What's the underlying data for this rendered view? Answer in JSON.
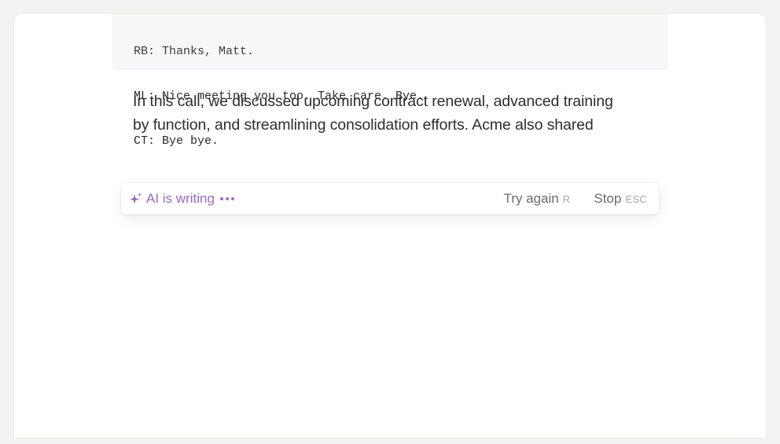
{
  "transcript": {
    "lines": [
      "RB: Thanks, Matt.",
      "ML: Nice meeting you too. Take care. Bye.",
      "CT: Bye bye."
    ]
  },
  "summary": {
    "text": "In this call, we discussed upcoming contract renewal, advanced training by function, and streamlining consolidation efforts. Acme also shared"
  },
  "ai_bar": {
    "status_label": "AI is writing",
    "status_icon": "sparkle-icon",
    "accent_color": "#9a6bb8",
    "try_again_label": "Try again",
    "try_again_shortcut": "R",
    "stop_label": "Stop",
    "stop_shortcut": "ESC"
  }
}
